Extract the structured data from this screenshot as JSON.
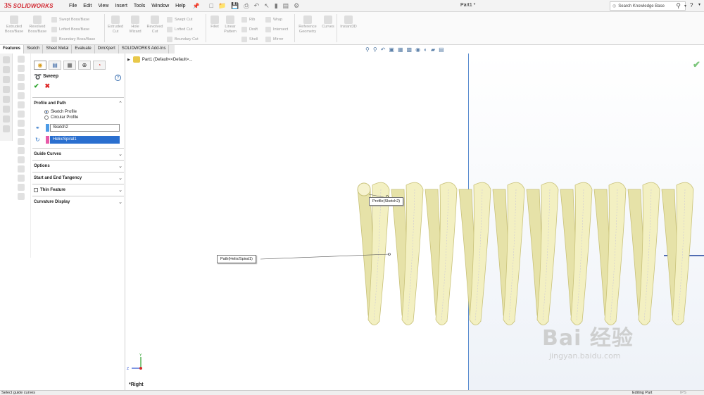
{
  "app": {
    "brand": "SOLIDWORKS",
    "document_title": "Part1 *",
    "search_placeholder": "Search Knowledge Base",
    "help_label": "?"
  },
  "menu": [
    "File",
    "Edit",
    "View",
    "Insert",
    "Tools",
    "Window",
    "Help"
  ],
  "command_manager": {
    "large_buttons": [
      {
        "label1": "Extruded",
        "label2": "Boss/Base"
      },
      {
        "label1": "Revolved",
        "label2": "Boss/Base"
      },
      {
        "label1": "Extruded",
        "label2": "Cut"
      },
      {
        "label1": "Hole",
        "label2": "Wizard"
      },
      {
        "label1": "Revolved",
        "label2": "Cut"
      },
      {
        "label1": "Fillet",
        "label2": ""
      },
      {
        "label1": "Linear",
        "label2": "Pattern"
      },
      {
        "label1": "Reference",
        "label2": "Geometry"
      },
      {
        "label1": "Curves",
        "label2": ""
      },
      {
        "label1": "Instant3D",
        "label2": ""
      }
    ],
    "small_buttons": [
      "Swept Boss/Base",
      "Lofted Boss/Base",
      "Boundary Boss/Base",
      "Swept Cut",
      "Lofted Cut",
      "Boundary Cut",
      "Rib",
      "Draft",
      "Shell",
      "Wrap",
      "Intersect",
      "Mirror"
    ]
  },
  "tabs": [
    "Features",
    "Sketch",
    "Sheet Metal",
    "Evaluate",
    "DimXpert",
    "SOLIDWORKS Add-Ins"
  ],
  "active_tab": "Features",
  "property_manager": {
    "title": "Sweep",
    "profile_and_path": {
      "header": "Profile and Path",
      "options": [
        "Sketch Profile",
        "Circular Profile"
      ],
      "selected_option": "Sketch Profile",
      "profile_value": "Sketch2",
      "path_value": "Helix/Spiral1"
    },
    "sections": [
      "Guide Curves",
      "Options",
      "Start and End Tangency",
      "Thin Feature",
      "Curvature Display"
    ]
  },
  "graphics": {
    "tree_item": "Part1  (Default<<Default>...",
    "profile_callout": "Profile(Sketch2)",
    "path_callout": "Path(Helix/Spiral1)",
    "view_label": "*Right",
    "axis_labels": {
      "y": "Y",
      "z": "Z"
    }
  },
  "status": {
    "left": "Select guide curves",
    "right": "Editing Part",
    "units": "IPS"
  },
  "watermark": {
    "main": "Bai  经验",
    "sub": "jingyan.baidu.com"
  },
  "colors": {
    "brand_red": "#d1262f",
    "spring_fill": "#f3f0c2",
    "spring_stroke": "#c9c27a",
    "ok_green": "#29a329",
    "selection_blue": "#2a6fcf"
  }
}
